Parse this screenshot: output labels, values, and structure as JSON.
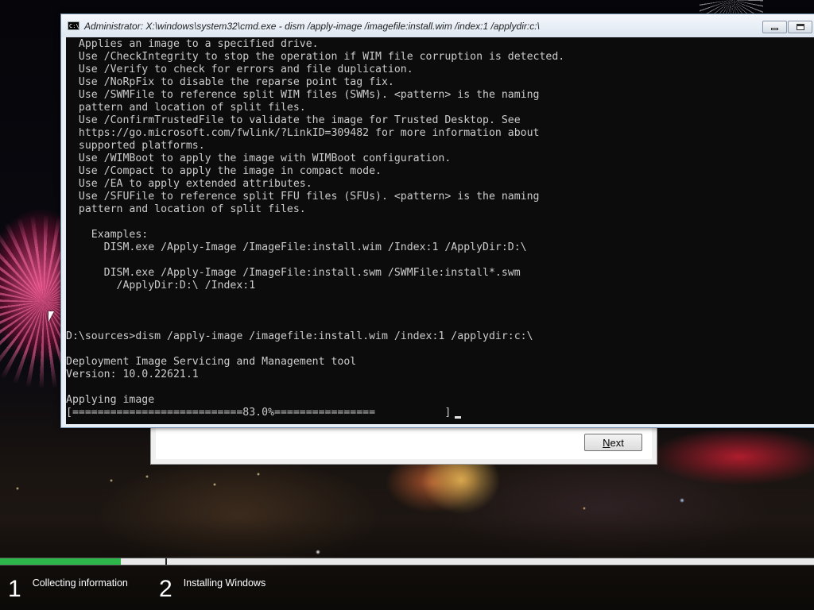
{
  "cmd": {
    "title": "Administrator: X:\\windows\\system32\\cmd.exe - dism  /apply-image /imagefile:install.wim /index:1 /applydir:c:\\",
    "icon": "cmd-icon",
    "output": "  Applies an image to a specified drive.\n  Use /CheckIntegrity to stop the operation if WIM file corruption is detected.\n  Use /Verify to check for errors and file duplication.\n  Use /NoRpFix to disable the reparse point tag fix.\n  Use /SWMFile to reference split WIM files (SWMs). <pattern> is the naming\n  pattern and location of split files.\n  Use /ConfirmTrustedFile to validate the image for Trusted Desktop. See\n  https://go.microsoft.com/fwlink/?LinkID=309482 for more information about\n  supported platforms.\n  Use /WIMBoot to apply the image with WIMBoot configuration.\n  Use /Compact to apply the image in compact mode.\n  Use /EA to apply extended attributes.\n  Use /SFUFile to reference split FFU files (SFUs). <pattern> is the naming\n  pattern and location of split files.\n\n    Examples:\n      DISM.exe /Apply-Image /ImageFile:install.wim /Index:1 /ApplyDir:D:\\\n\n      DISM.exe /Apply-Image /ImageFile:install.swm /SWMFile:install*.swm\n        /ApplyDir:D:\\ /Index:1\n\n\n\nD:\\sources>dism /apply-image /imagefile:install.wim /index:1 /applydir:c:\\\n\nDeployment Image Servicing and Management tool\nVersion: 10.0.22621.1\n\nApplying image\n[===========================83.0%================           ]",
    "progress_percent": 83.0
  },
  "setup": {
    "next_label": "Next",
    "steps": [
      {
        "number": "1",
        "label": "Collecting information"
      },
      {
        "number": "2",
        "label": "Installing Windows"
      }
    ],
    "overall_progress_fraction": 0.148
  },
  "colors": {
    "console_bg": "#0c0c0c",
    "console_text": "#cccccc",
    "progress_green": "#2db64a"
  }
}
